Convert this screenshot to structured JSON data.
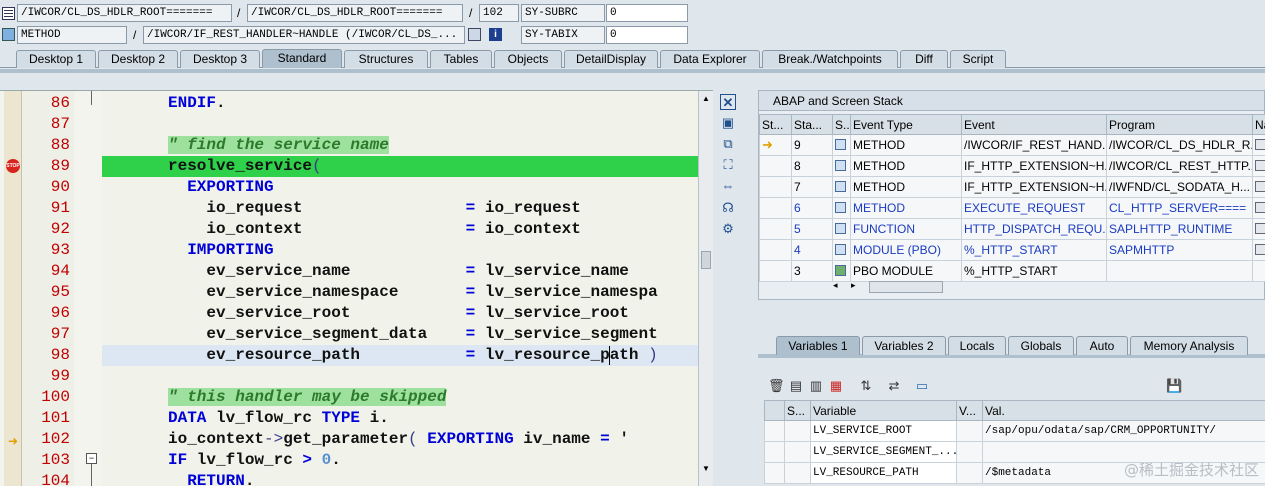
{
  "header": {
    "row1": {
      "field1": "/IWCOR/CL_DS_HDLR_ROOT=======",
      "sep1": "/",
      "field2": "/IWCOR/CL_DS_HDLR_ROOT=======",
      "sep2": "/",
      "line": "102",
      "sysvar_name": "SY-SUBRC",
      "sysvar_value": "0"
    },
    "row2": {
      "type": "METHOD",
      "sep": "/",
      "name": "/IWCOR/IF_REST_HANDLER~HANDLE (/IWCOR/CL_DS_...",
      "sysvar_name": "SY-TABIX",
      "sysvar_value": "0"
    }
  },
  "tabs": [
    "Desktop 1",
    "Desktop 2",
    "Desktop 3",
    "Standard",
    "Structures",
    "Tables",
    "Objects",
    "DetailDisplay",
    "Data Explorer",
    "Break./Watchpoints",
    "Diff",
    "Script"
  ],
  "editor": {
    "lines": [
      "86",
      "87",
      "88",
      "89",
      "90",
      "91",
      "92",
      "93",
      "94",
      "95",
      "96",
      "97",
      "98",
      "99",
      "100",
      "101",
      "102",
      "103",
      "104"
    ]
  },
  "stack": {
    "title": "ABAP and Screen Stack",
    "columns": [
      "St...",
      "Sta...",
      "S...",
      "Event Type",
      "Event",
      "Program",
      "Na"
    ],
    "rows": [
      {
        "level": "9",
        "type": "METHOD",
        "event": "/IWCOR/IF_REST_HAND...",
        "program": "/IWCOR/CL_DS_HDLR_R..."
      },
      {
        "level": "8",
        "type": "METHOD",
        "event": "IF_HTTP_EXTENSION~H...",
        "program": "/IWCOR/CL_REST_HTTP..."
      },
      {
        "level": "7",
        "type": "METHOD",
        "event": "IF_HTTP_EXTENSION~H...",
        "program": "/IWFND/CL_SODATA_H..."
      },
      {
        "level": "6",
        "type": "METHOD",
        "event": "EXECUTE_REQUEST",
        "program": "CL_HTTP_SERVER===="
      },
      {
        "level": "5",
        "type": "FUNCTION",
        "event": "HTTP_DISPATCH_REQU...",
        "program": "SAPLHTTP_RUNTIME"
      },
      {
        "level": "4",
        "type": "MODULE (PBO)",
        "event": "%_HTTP_START",
        "program": "SAPMHTTP"
      },
      {
        "level": "3",
        "type": "PBO MODULE",
        "event": "%_HTTP_START",
        "program": ""
      }
    ]
  },
  "var_tabs": [
    "Variables 1",
    "Variables 2",
    "Locals",
    "Globals",
    "Auto",
    "Memory Analysis"
  ],
  "variables": {
    "columns": [
      "S...",
      "Variable",
      "V...",
      "Val."
    ],
    "rows": [
      {
        "name": "LV_SERVICE_ROOT",
        "value": "/sap/opu/odata/sap/CRM_OPPORTUNITY/"
      },
      {
        "name": "LV_SERVICE_SEGMENT_...",
        "value": ""
      },
      {
        "name": "LV_RESOURCE_PATH",
        "value": "/$metadata"
      }
    ]
  },
  "watermark": "@稀土掘金技术社区"
}
